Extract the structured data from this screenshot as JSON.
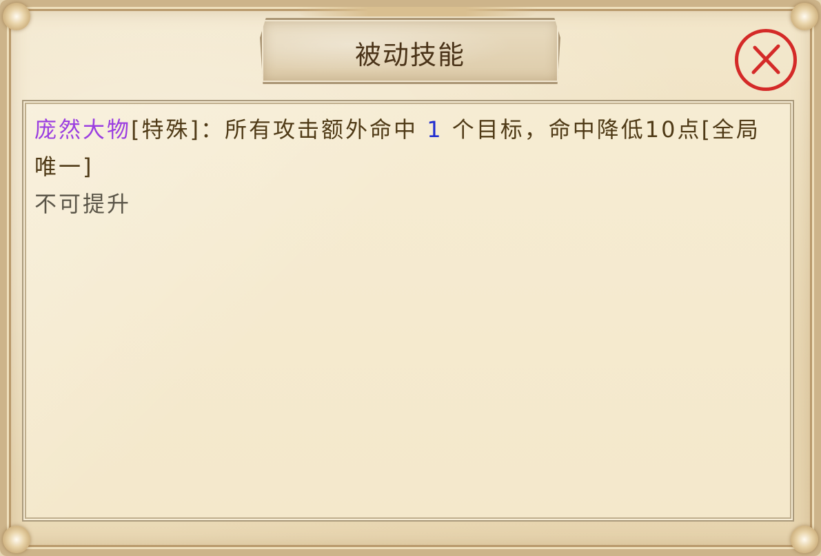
{
  "dialog": {
    "title": "被动技能",
    "close_icon": "close-x-icon",
    "colors": {
      "skill_name": "#9b3ee0",
      "body_text": "#4f3a16",
      "number_highlight": "#1f2bd0",
      "status_text": "#5a5548",
      "close_red": "#d42a28"
    }
  },
  "skill": {
    "name": "庞然大物",
    "tag": "[特殊]：",
    "desc_part1": "所有攻击额外命中 ",
    "number": "1",
    "desc_part2": " 个目标，命中降低10点[全局唯一]",
    "upgrade_status": "不可提升"
  }
}
